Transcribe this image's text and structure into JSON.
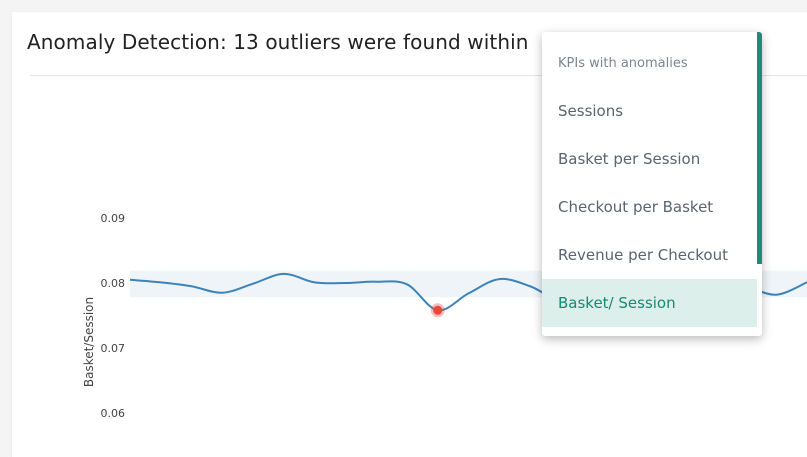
{
  "card": {
    "title": "Anomaly Detection: 13 outliers were found within"
  },
  "chart_data": {
    "type": "line",
    "ylabel": "Basket/Session",
    "yticks": [
      "0.09",
      "0.08",
      "0.07",
      "0.06"
    ],
    "ylim": [
      0.06,
      0.09
    ],
    "band": [
      0.0778,
      0.0819
    ],
    "series": [
      {
        "values": [
          0.0805,
          0.0801,
          0.0795,
          0.0785,
          0.0799,
          0.0814,
          0.0801,
          0.08,
          0.0802,
          0.0798,
          0.0758,
          0.0784,
          0.0806,
          0.0795,
          0.0774,
          0.0791,
          0.0795,
          0.0799,
          0.08,
          0.0801,
          0.0795,
          0.0782,
          0.0801
        ]
      }
    ],
    "anomalies": [
      {
        "index": 10,
        "value": 0.0758
      },
      {
        "index": 14,
        "value": 0.0774
      }
    ],
    "colors": {
      "line": "#3b83b8",
      "band": "#eef4f8",
      "anomaly": "#e8473b"
    }
  },
  "dropdown": {
    "header": "KPIs with anomalies",
    "items": [
      "Sessions",
      "Basket per Session",
      "Checkout per Basket",
      "Revenue per Checkout",
      "Basket/ Session"
    ],
    "selected": "Basket/ Session",
    "accent": "#1a8c78"
  }
}
